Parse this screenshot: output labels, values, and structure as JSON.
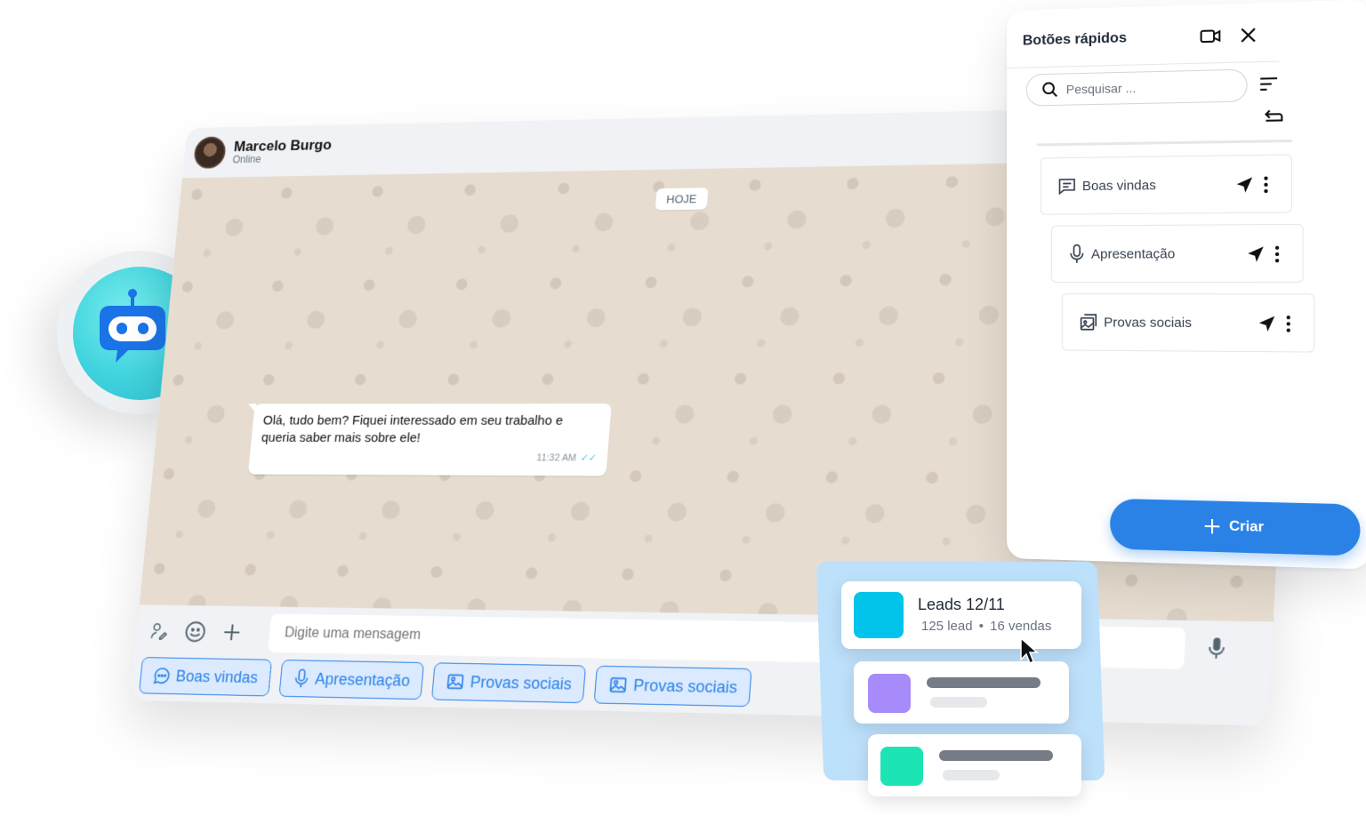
{
  "chat": {
    "contact_name": "Marcelo Burgo",
    "contact_status": "Online",
    "date_badge": "HOJE",
    "message": {
      "line1": "Olá, tudo bem? Fiquei interessado em seu trabalho e",
      "line2": "queria saber mais sobre ele!",
      "time": "11:32 AM"
    },
    "composer_placeholder": "Digite uma mensagem",
    "quick_chips": [
      {
        "label": "Boas vindas",
        "icon": "chat-bubble-icon"
      },
      {
        "label": "Apresentação",
        "icon": "microphone-icon"
      },
      {
        "label": "Provas sociais",
        "icon": "image-icon"
      },
      {
        "label": "Provas sociais",
        "icon": "image-icon"
      }
    ]
  },
  "panel": {
    "title": "Botões rápidos",
    "search_placeholder": "Pesquisar ...",
    "items": [
      {
        "label": "Boas vindas",
        "icon": "message-square-icon"
      },
      {
        "label": "Apresentação",
        "icon": "microphone-icon"
      },
      {
        "label": "Provas sociais",
        "icon": "images-icon"
      }
    ],
    "create_label": "Criar"
  },
  "leads": {
    "title": "Leads 12/11",
    "sub_leads": "125 lead",
    "sub_sales": "16 vendas",
    "colors": {
      "card1": "#00c4ea",
      "card2": "#a78bfa",
      "card3": "#1de4b4"
    }
  },
  "colors": {
    "accent": "#2b82e6",
    "chat_wallpaper": "#e6ddd0",
    "bot": "#3fd3de"
  }
}
